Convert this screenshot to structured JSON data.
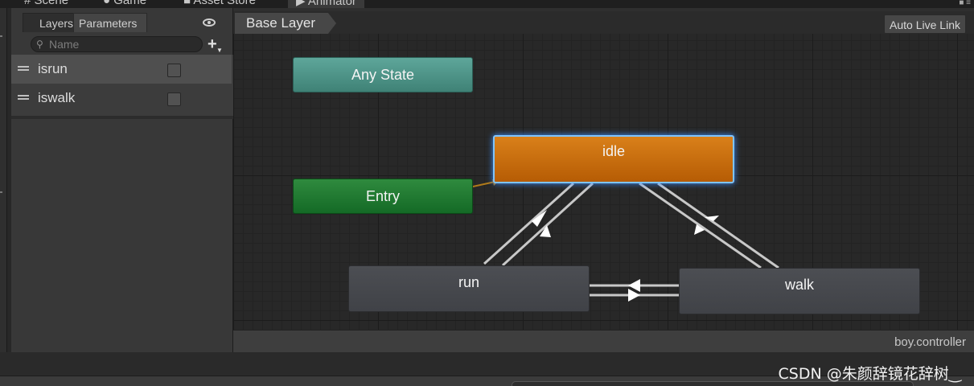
{
  "top_tabs": [
    {
      "label": "Scene",
      "icon": "hash-icon"
    },
    {
      "label": "Game",
      "icon": "pacman-icon"
    },
    {
      "label": "Asset Store",
      "icon": "bag-icon"
    },
    {
      "label": "Animator",
      "icon": "animator-icon"
    }
  ],
  "left_panel": {
    "tabs": {
      "layers": "Layers",
      "parameters": "Parameters"
    },
    "search_placeholder": "Name",
    "parameters": [
      {
        "name": "isrun",
        "value": false
      },
      {
        "name": "iswalk",
        "value": false
      }
    ]
  },
  "graph": {
    "breadcrumb": "Base Layer",
    "auto_live_link": "Auto Live Link",
    "states": {
      "any": "Any State",
      "entry": "Entry",
      "idle": "idle",
      "run": "run",
      "walk": "walk"
    },
    "controller_name": "boy.controller"
  },
  "watermark": "CSDN @朱颜辞镜花辞树‿",
  "colors": {
    "any_state": "#4f968a",
    "entry_state": "#1f7a32",
    "default_state": "#c96e0e",
    "normal_state": "#46484d",
    "selection_glow": "#3c8eff"
  }
}
